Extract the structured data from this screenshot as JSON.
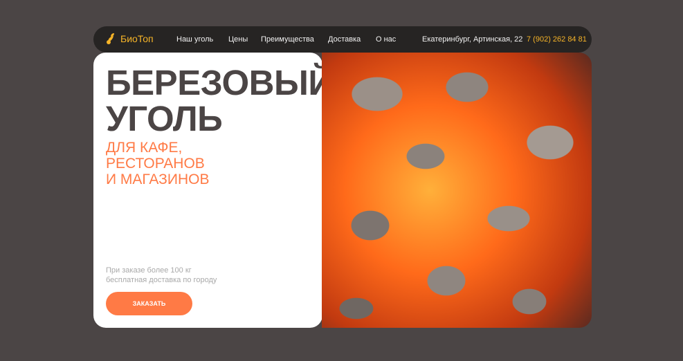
{
  "nav": {
    "logo": "БиоТоп",
    "items": [
      "Наш уголь",
      "Цены",
      "Преимущества",
      "Доставка",
      "О нас"
    ],
    "address": "Екатеринбург, Артинская, 22",
    "phone": "7 (902) 262 84 81"
  },
  "hero": {
    "title_line1": "БЕРЕЗОВЫЙ",
    "title_line2": "УГОЛЬ",
    "subtitle_line1": "ДЛЯ КАФЕ,",
    "subtitle_line2": "РЕСТОРАНОВ",
    "subtitle_line3": "И МАГАЗИНОВ",
    "note_line1": "При заказе более 100 кг",
    "note_line2": "бесплатная доставка по городу",
    "button": "ЗАКАЗАТЬ"
  },
  "colors": {
    "accent": "#ff7a45",
    "logo": "#f6b428",
    "background": "#4b4545"
  }
}
